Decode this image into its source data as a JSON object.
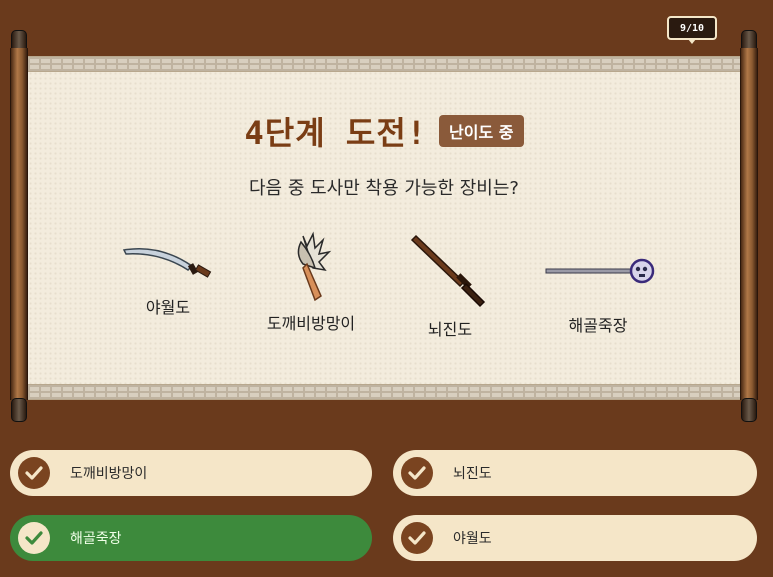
{
  "progress": "9/10",
  "title": "4단계 도전!",
  "difficulty": "난이도 중",
  "question": "다음 중 도사만 착용 가능한 장비는?",
  "items": [
    {
      "label": "야월도",
      "icon": "curved-blade-icon"
    },
    {
      "label": "도깨비방망이",
      "icon": "spiked-club-icon"
    },
    {
      "label": "뇌진도",
      "icon": "dark-sword-icon"
    },
    {
      "label": "해골죽장",
      "icon": "skull-staff-icon"
    }
  ],
  "answers": [
    {
      "label": "도깨비방망이",
      "state": "default"
    },
    {
      "label": "뇌진도",
      "state": "default"
    },
    {
      "label": "해골죽장",
      "state": "correct"
    },
    {
      "label": "야월도",
      "state": "default"
    }
  ],
  "colors": {
    "background": "#6a3a1c",
    "title": "#7a3d14",
    "answer_default": "#f5e6c8",
    "answer_correct": "#3d8a3c",
    "check_circle": "#7a4420"
  }
}
